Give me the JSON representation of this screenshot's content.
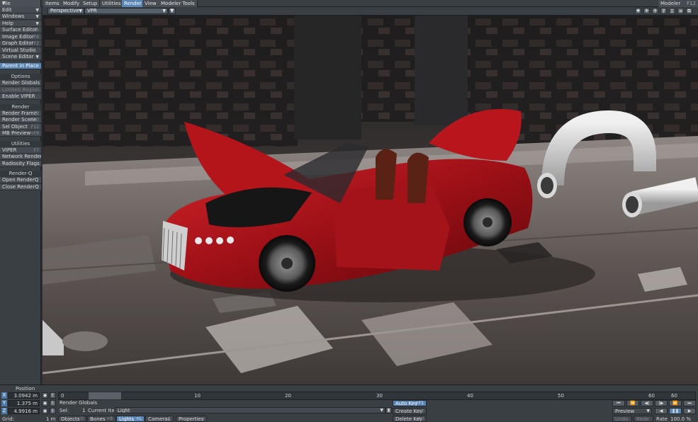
{
  "menu": {
    "file": "File"
  },
  "tabs": [
    "Items",
    "Modify",
    "Setup",
    "Utilities",
    "Render",
    "View",
    "Modeler Tools"
  ],
  "modeler": {
    "label": "Modeler",
    "key": "F12"
  },
  "sidebar": {
    "top_items": [
      {
        "label": "Edit",
        "key": ""
      },
      {
        "label": "Windows",
        "key": ""
      },
      {
        "label": "Help",
        "key": ""
      },
      {
        "label": "Surface Editor",
        "key": "F5"
      },
      {
        "label": "Image Editor",
        "key": "F6"
      },
      {
        "label": "Graph Editor",
        "key": "^F2"
      },
      {
        "label": "Virtual Studio",
        "key": ""
      },
      {
        "label": "Scene Editor",
        "key": ""
      }
    ],
    "parent_in_place": "Parent in Place",
    "options_head": "Options",
    "options": [
      {
        "label": "Render Globals",
        "key": ""
      },
      {
        "label": "Limited Region",
        "key": ""
      },
      {
        "label": "Enable VIPER",
        "key": ""
      }
    ],
    "render_head": "Render",
    "render": [
      {
        "label": "Render Frame",
        "key": "F9"
      },
      {
        "label": "Render Scene",
        "key": "F10"
      },
      {
        "label": "Sel Object",
        "key": "F11"
      },
      {
        "label": "MB Preview",
        "key": "+F9"
      }
    ],
    "utilities_head": "Utilities",
    "utilities": [
      {
        "label": "VIPER",
        "key": "F7"
      },
      {
        "label": "Network Render",
        "key": ""
      },
      {
        "label": "Radiosity Flags",
        "key": ""
      }
    ],
    "renderq_head": "Render-Q",
    "renderq": [
      {
        "label": "Open RenderQ",
        "key": ""
      },
      {
        "label": "Close RenderQ",
        "key": ""
      }
    ]
  },
  "viewport": {
    "view_mode": "Perspective",
    "render_mode": "VPR"
  },
  "bottom": {
    "position_label": "Position",
    "x_label": "X",
    "x_value": "3.0942 m",
    "y_label": "Y",
    "y_value": "1.375 m",
    "z_label": "Z",
    "z_value": "4.9916 m",
    "grid_label": "Grid:",
    "grid_value": "1 m",
    "frame_start": "0",
    "ticks": [
      "0",
      "10",
      "20",
      "30",
      "40",
      "50",
      "60"
    ],
    "frame_end": "60",
    "render_globals": "Render Globals",
    "sel_label": "Sel:",
    "sel_count": "1",
    "current_item_label": "Current Item",
    "current_item_value": "Light",
    "auto_key": "Auto Key",
    "auto_key_key": "+F1",
    "create_key": "Create Key",
    "create_key_key": "ret",
    "delete_key": "Delete Key",
    "delete_key_key": "del",
    "objects": "Objects",
    "objects_key": "+O",
    "bones": "Bones",
    "bones_key": "+B",
    "lights": "Lights",
    "lights_key": "+L",
    "cameras": "Cameras",
    "cameras_key": "+C",
    "properties": "Properties",
    "properties_key": "p",
    "preview": "Preview",
    "undo": "Undo",
    "redo": "Redo",
    "rate_label": "Rate",
    "rate_value": "100.0 %"
  }
}
